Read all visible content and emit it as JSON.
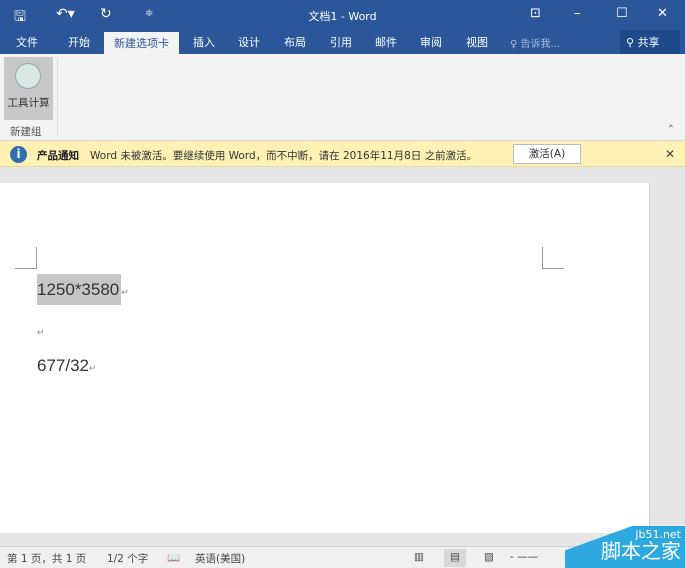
{
  "title": "文档1 - Word",
  "tabs": [
    "文件",
    "开始",
    "新建选项卡",
    "插入",
    "设计",
    "布局",
    "引用",
    "邮件",
    "审阅",
    "视图"
  ],
  "tell_me": "告诉我...",
  "share": "共享",
  "ribbon": {
    "tool_label": "工具计算",
    "group_label": "新建组"
  },
  "notice": {
    "title": "产品通知",
    "message": "Word 未被激活。要继续使用 Word，而不中断，请在 2016年11月8日 之前激活。",
    "button": "激活(A)"
  },
  "document": {
    "lines": [
      "1250*3580",
      "",
      "677/32"
    ],
    "para_mark": "↵"
  },
  "status": {
    "page": "第 1 页，共 1 页",
    "words": "1/2 个字",
    "language": "英语(美国)"
  },
  "watermark": {
    "site": "jb51.net",
    "name": "脚本之家"
  }
}
